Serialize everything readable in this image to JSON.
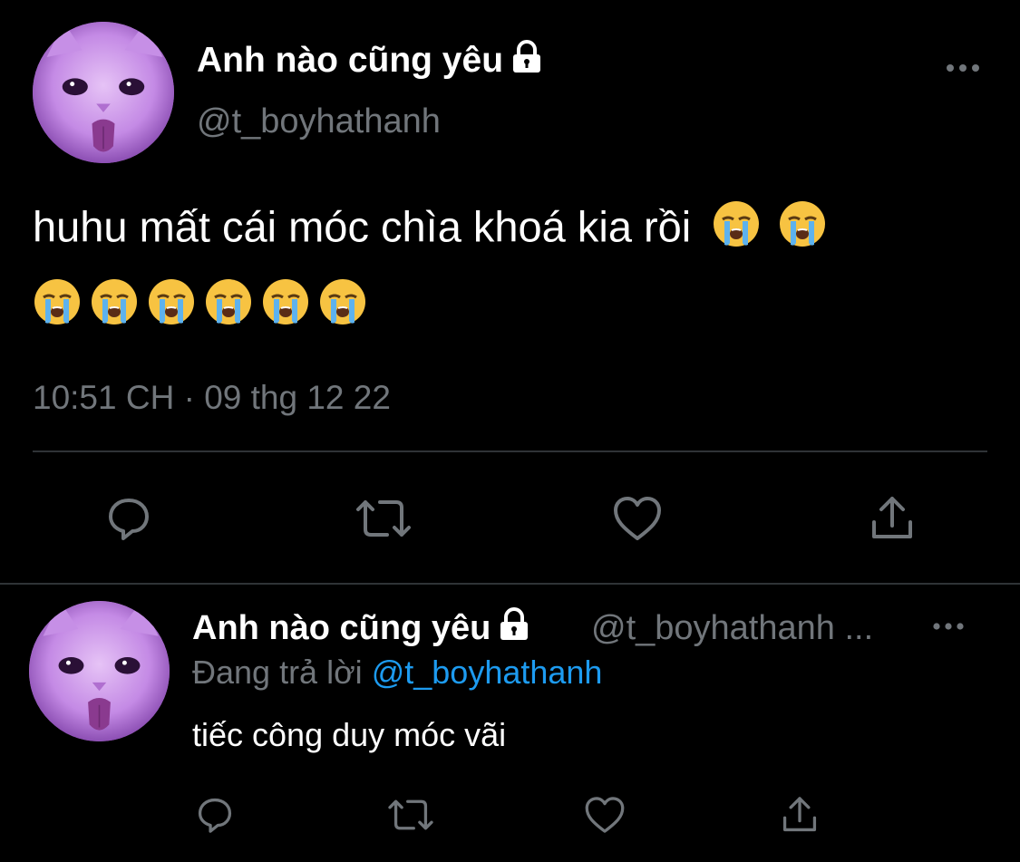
{
  "main_tweet": {
    "author_name": "Anh nào cũng yêu",
    "handle": "@t_boyhathanh",
    "text": "huhu mất cái móc chìa khoá kia rồi",
    "emoji_inline_count": 2,
    "emoji_line_count": 6,
    "timestamp": "10:51 CH · 09 thg 12 22",
    "icons": {
      "lock": "lock-icon",
      "more": "more-horizontal-icon",
      "reply": "reply-icon",
      "retweet": "retweet-icon",
      "like": "heart-icon",
      "share": "share-icon",
      "emoji": "loudly-crying-face-emoji"
    }
  },
  "reply_tweet": {
    "author_name": "Anh nào cũng yêu",
    "handle": "@t_boyhathanh ...",
    "replying_prefix": "Đang trả lời",
    "replying_to": "@t_boyhathanh",
    "text": "tiếc công duy móc vãi"
  },
  "colors": {
    "background": "#000000",
    "text": "#ffffff",
    "secondary_text": "#71767b",
    "link": "#1d9bf0",
    "divider": "#2f3336",
    "avatar": "#bb7fe0"
  }
}
